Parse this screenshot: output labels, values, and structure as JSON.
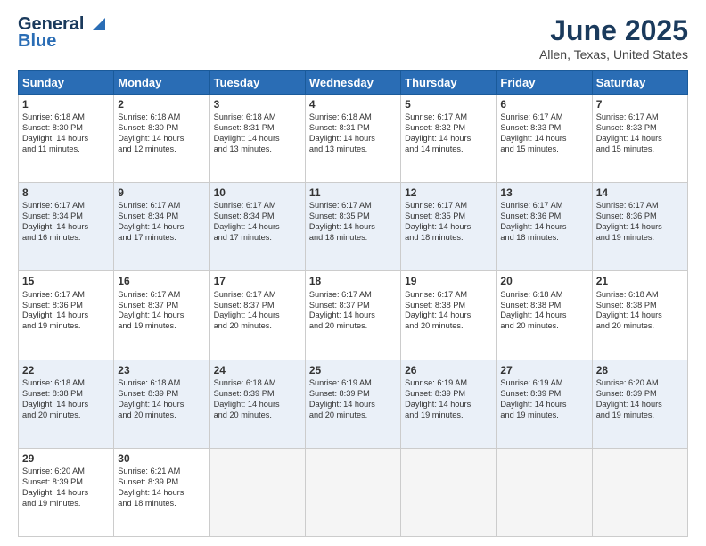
{
  "header": {
    "logo_line1": "General",
    "logo_line2": "Blue",
    "title": "June 2025",
    "subtitle": "Allen, Texas, United States"
  },
  "columns": [
    "Sunday",
    "Monday",
    "Tuesday",
    "Wednesday",
    "Thursday",
    "Friday",
    "Saturday"
  ],
  "weeks": [
    {
      "shade": false,
      "days": [
        {
          "num": "1",
          "lines": [
            "Sunrise: 6:18 AM",
            "Sunset: 8:30 PM",
            "Daylight: 14 hours",
            "and 11 minutes."
          ]
        },
        {
          "num": "2",
          "lines": [
            "Sunrise: 6:18 AM",
            "Sunset: 8:30 PM",
            "Daylight: 14 hours",
            "and 12 minutes."
          ]
        },
        {
          "num": "3",
          "lines": [
            "Sunrise: 6:18 AM",
            "Sunset: 8:31 PM",
            "Daylight: 14 hours",
            "and 13 minutes."
          ]
        },
        {
          "num": "4",
          "lines": [
            "Sunrise: 6:18 AM",
            "Sunset: 8:31 PM",
            "Daylight: 14 hours",
            "and 13 minutes."
          ]
        },
        {
          "num": "5",
          "lines": [
            "Sunrise: 6:17 AM",
            "Sunset: 8:32 PM",
            "Daylight: 14 hours",
            "and 14 minutes."
          ]
        },
        {
          "num": "6",
          "lines": [
            "Sunrise: 6:17 AM",
            "Sunset: 8:33 PM",
            "Daylight: 14 hours",
            "and 15 minutes."
          ]
        },
        {
          "num": "7",
          "lines": [
            "Sunrise: 6:17 AM",
            "Sunset: 8:33 PM",
            "Daylight: 14 hours",
            "and 15 minutes."
          ]
        }
      ]
    },
    {
      "shade": true,
      "days": [
        {
          "num": "8",
          "lines": [
            "Sunrise: 6:17 AM",
            "Sunset: 8:34 PM",
            "Daylight: 14 hours",
            "and 16 minutes."
          ]
        },
        {
          "num": "9",
          "lines": [
            "Sunrise: 6:17 AM",
            "Sunset: 8:34 PM",
            "Daylight: 14 hours",
            "and 17 minutes."
          ]
        },
        {
          "num": "10",
          "lines": [
            "Sunrise: 6:17 AM",
            "Sunset: 8:34 PM",
            "Daylight: 14 hours",
            "and 17 minutes."
          ]
        },
        {
          "num": "11",
          "lines": [
            "Sunrise: 6:17 AM",
            "Sunset: 8:35 PM",
            "Daylight: 14 hours",
            "and 18 minutes."
          ]
        },
        {
          "num": "12",
          "lines": [
            "Sunrise: 6:17 AM",
            "Sunset: 8:35 PM",
            "Daylight: 14 hours",
            "and 18 minutes."
          ]
        },
        {
          "num": "13",
          "lines": [
            "Sunrise: 6:17 AM",
            "Sunset: 8:36 PM",
            "Daylight: 14 hours",
            "and 18 minutes."
          ]
        },
        {
          "num": "14",
          "lines": [
            "Sunrise: 6:17 AM",
            "Sunset: 8:36 PM",
            "Daylight: 14 hours",
            "and 19 minutes."
          ]
        }
      ]
    },
    {
      "shade": false,
      "days": [
        {
          "num": "15",
          "lines": [
            "Sunrise: 6:17 AM",
            "Sunset: 8:36 PM",
            "Daylight: 14 hours",
            "and 19 minutes."
          ]
        },
        {
          "num": "16",
          "lines": [
            "Sunrise: 6:17 AM",
            "Sunset: 8:37 PM",
            "Daylight: 14 hours",
            "and 19 minutes."
          ]
        },
        {
          "num": "17",
          "lines": [
            "Sunrise: 6:17 AM",
            "Sunset: 8:37 PM",
            "Daylight: 14 hours",
            "and 20 minutes."
          ]
        },
        {
          "num": "18",
          "lines": [
            "Sunrise: 6:17 AM",
            "Sunset: 8:37 PM",
            "Daylight: 14 hours",
            "and 20 minutes."
          ]
        },
        {
          "num": "19",
          "lines": [
            "Sunrise: 6:17 AM",
            "Sunset: 8:38 PM",
            "Daylight: 14 hours",
            "and 20 minutes."
          ]
        },
        {
          "num": "20",
          "lines": [
            "Sunrise: 6:18 AM",
            "Sunset: 8:38 PM",
            "Daylight: 14 hours",
            "and 20 minutes."
          ]
        },
        {
          "num": "21",
          "lines": [
            "Sunrise: 6:18 AM",
            "Sunset: 8:38 PM",
            "Daylight: 14 hours",
            "and 20 minutes."
          ]
        }
      ]
    },
    {
      "shade": true,
      "days": [
        {
          "num": "22",
          "lines": [
            "Sunrise: 6:18 AM",
            "Sunset: 8:38 PM",
            "Daylight: 14 hours",
            "and 20 minutes."
          ]
        },
        {
          "num": "23",
          "lines": [
            "Sunrise: 6:18 AM",
            "Sunset: 8:39 PM",
            "Daylight: 14 hours",
            "and 20 minutes."
          ]
        },
        {
          "num": "24",
          "lines": [
            "Sunrise: 6:18 AM",
            "Sunset: 8:39 PM",
            "Daylight: 14 hours",
            "and 20 minutes."
          ]
        },
        {
          "num": "25",
          "lines": [
            "Sunrise: 6:19 AM",
            "Sunset: 8:39 PM",
            "Daylight: 14 hours",
            "and 20 minutes."
          ]
        },
        {
          "num": "26",
          "lines": [
            "Sunrise: 6:19 AM",
            "Sunset: 8:39 PM",
            "Daylight: 14 hours",
            "and 19 minutes."
          ]
        },
        {
          "num": "27",
          "lines": [
            "Sunrise: 6:19 AM",
            "Sunset: 8:39 PM",
            "Daylight: 14 hours",
            "and 19 minutes."
          ]
        },
        {
          "num": "28",
          "lines": [
            "Sunrise: 6:20 AM",
            "Sunset: 8:39 PM",
            "Daylight: 14 hours",
            "and 19 minutes."
          ]
        }
      ]
    },
    {
      "shade": false,
      "days": [
        {
          "num": "29",
          "lines": [
            "Sunrise: 6:20 AM",
            "Sunset: 8:39 PM",
            "Daylight: 14 hours",
            "and 19 minutes."
          ]
        },
        {
          "num": "30",
          "lines": [
            "Sunrise: 6:21 AM",
            "Sunset: 8:39 PM",
            "Daylight: 14 hours",
            "and 18 minutes."
          ]
        },
        {
          "num": "",
          "lines": []
        },
        {
          "num": "",
          "lines": []
        },
        {
          "num": "",
          "lines": []
        },
        {
          "num": "",
          "lines": []
        },
        {
          "num": "",
          "lines": []
        }
      ]
    }
  ]
}
